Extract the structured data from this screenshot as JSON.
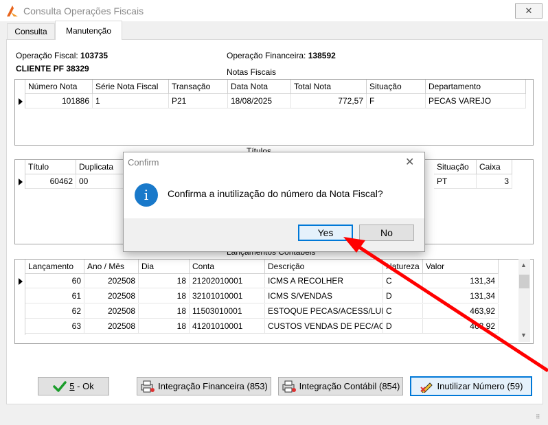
{
  "window": {
    "title": "Consulta Operações Fiscais",
    "close_glyph": "✕"
  },
  "tabs": [
    {
      "label": "Consulta"
    },
    {
      "label": "Manutenção"
    }
  ],
  "info": {
    "op_fiscal_label": "Operação Fiscal:",
    "op_fiscal_value": "103735",
    "cliente": "CLIENTE PF 38329",
    "op_financeira_label": "Operação Financeira:",
    "op_financeira_value": "138592"
  },
  "notas": {
    "title": "Notas Fiscais",
    "columns": [
      "Número Nota",
      "Série Nota Fiscal",
      "Transação",
      "Data Nota",
      "Total Nota",
      "Situação",
      "Departamento"
    ],
    "rows": [
      [
        "101886",
        "1",
        "P21",
        "18/08/2025",
        "772,57",
        "F",
        "PECAS VAREJO"
      ]
    ]
  },
  "titulos": {
    "title": "Títulos",
    "columns": [
      "Título",
      "Duplicata",
      "Situação",
      "Caixa"
    ],
    "rows": [
      [
        "60462",
        "00",
        "PT",
        "3"
      ]
    ]
  },
  "lancamentos": {
    "title": "Lançamentos Contábeis",
    "columns": [
      "Lançamento",
      "Ano / Mês",
      "Dia",
      "Conta",
      "Descrição",
      "Natureza",
      "Valor"
    ],
    "rows": [
      [
        "60",
        "202508",
        "18",
        "21202010001",
        "ICMS A RECOLHER",
        "C",
        "131,34"
      ],
      [
        "61",
        "202508",
        "18",
        "32101010001",
        "ICMS S/VENDAS",
        "D",
        "131,34"
      ],
      [
        "62",
        "202508",
        "18",
        "11503010001",
        "ESTOQUE PECAS/ACESS/LUB",
        "C",
        "463,92"
      ],
      [
        "63",
        "202508",
        "18",
        "41201010001",
        "CUSTOS VENDAS DE PEC/AC",
        "D",
        "463,92"
      ]
    ]
  },
  "buttons": {
    "ok_mnemonic": "5",
    "ok_rest": " - Ok",
    "int_fin": "Integração Financeira (853)",
    "int_cont": "Integração Contábil (854)",
    "inutilizar": "Inutilizar Número (59)"
  },
  "dialog": {
    "title": "Confirm",
    "icon": "i",
    "message": "Confirma a inutilização do número da Nota Fiscal?",
    "yes": "Yes",
    "no": "No",
    "close_glyph": "✕"
  },
  "colors": {
    "accent": "#0078d7",
    "info_icon": "#1979ca",
    "arrow": "#ff0000"
  }
}
